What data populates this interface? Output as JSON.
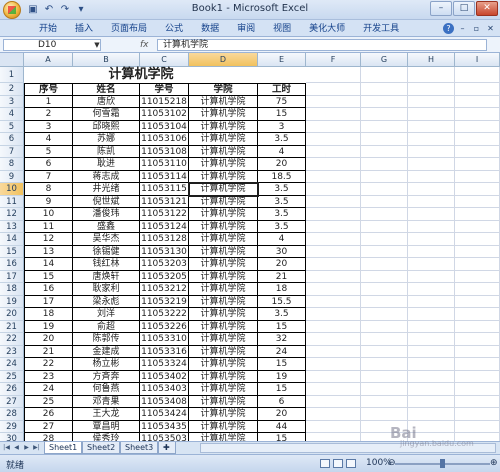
{
  "window": {
    "title": "Book1 - Microsoft Excel"
  },
  "quick_access": [
    "save-icon",
    "undo-icon",
    "redo-icon",
    "dropdown-icon"
  ],
  "ribbon": {
    "tabs": [
      "开始",
      "插入",
      "页面布局",
      "公式",
      "数据",
      "审阅",
      "视图",
      "美化大师",
      "开发工具"
    ]
  },
  "formula_bar": {
    "name_box": "D10",
    "fx_label": "fx",
    "formula": "计算机学院"
  },
  "columns": [
    "A",
    "B",
    "C",
    "D",
    "E",
    "F",
    "G",
    "H",
    "I"
  ],
  "sheet": {
    "title": "计算机学院",
    "headers": [
      "序号",
      "姓名",
      "学号",
      "学院",
      "工时"
    ],
    "rows": [
      [
        "1",
        "唐欣",
        "11015218",
        "计算机学院",
        "75"
      ],
      [
        "2",
        "何雪霜",
        "11053102",
        "计算机学院",
        "15"
      ],
      [
        "3",
        "邱晓熙",
        "11053104",
        "计算机学院",
        "3"
      ],
      [
        "4",
        "苏娜",
        "11053106",
        "计算机学院",
        "3.5"
      ],
      [
        "5",
        "陈凯",
        "11053108",
        "计算机学院",
        "4"
      ],
      [
        "6",
        "耿进",
        "11053110",
        "计算机学院",
        "20"
      ],
      [
        "7",
        "蒋志成",
        "11053114",
        "计算机学院",
        "18.5"
      ],
      [
        "8",
        "井光绪",
        "11053115",
        "计算机学院",
        "3.5"
      ],
      [
        "9",
        "倪世斌",
        "11053121",
        "计算机学院",
        "3.5"
      ],
      [
        "10",
        "潘俊玮",
        "11053122",
        "计算机学院",
        "3.5"
      ],
      [
        "11",
        "盛鑫",
        "11053124",
        "计算机学院",
        "3.5"
      ],
      [
        "12",
        "吴华杰",
        "11053128",
        "计算机学院",
        "4"
      ],
      [
        "13",
        "徐锡健",
        "11053130",
        "计算机学院",
        "30"
      ],
      [
        "14",
        "钱红林",
        "11053203",
        "计算机学院",
        "20"
      ],
      [
        "15",
        "唐焕轩",
        "11053205",
        "计算机学院",
        "21"
      ],
      [
        "16",
        "耿家利",
        "11053212",
        "计算机学院",
        "18"
      ],
      [
        "17",
        "梁永彪",
        "11053219",
        "计算机学院",
        "15.5"
      ],
      [
        "18",
        "刘洋",
        "11053222",
        "计算机学院",
        "3.5"
      ],
      [
        "19",
        "俞超",
        "11053226",
        "计算机学院",
        "15"
      ],
      [
        "20",
        "陈郭传",
        "11053310",
        "计算机学院",
        "32"
      ],
      [
        "21",
        "金建成",
        "11053316",
        "计算机学院",
        "24"
      ],
      [
        "22",
        "杨立彬",
        "11053324",
        "计算机学院",
        "15"
      ],
      [
        "23",
        "方斉奔",
        "11053402",
        "计算机学院",
        "19"
      ],
      [
        "24",
        "何鲁燕",
        "11053403",
        "计算机学院",
        "15"
      ],
      [
        "25",
        "邓青果",
        "11053408",
        "计算机学院",
        "6"
      ],
      [
        "26",
        "王大龙",
        "11053424",
        "计算机学院",
        "20"
      ],
      [
        "27",
        "覃昌明",
        "11053435",
        "计算机学院",
        "44"
      ],
      [
        "28",
        "侯秀玲",
        "11053503",
        "计算机学院",
        "15"
      ]
    ],
    "row_numbers": [
      "1",
      "2",
      "3",
      "4",
      "5",
      "6",
      "7",
      "8",
      "9",
      "10",
      "11",
      "12",
      "13",
      "14",
      "15",
      "16",
      "17",
      "18",
      "19",
      "20",
      "21",
      "22",
      "23",
      "24",
      "25",
      "26",
      "27",
      "28",
      "29",
      "30"
    ]
  },
  "sheet_tabs": [
    "Sheet1",
    "Sheet2",
    "Sheet3"
  ],
  "status": {
    "text": "就绪",
    "zoom": "100%",
    "zoom_minus": "⊖",
    "zoom_plus": "⊕"
  },
  "watermark": {
    "text": "Bai",
    "sub": "jingyan.baidu.com"
  }
}
